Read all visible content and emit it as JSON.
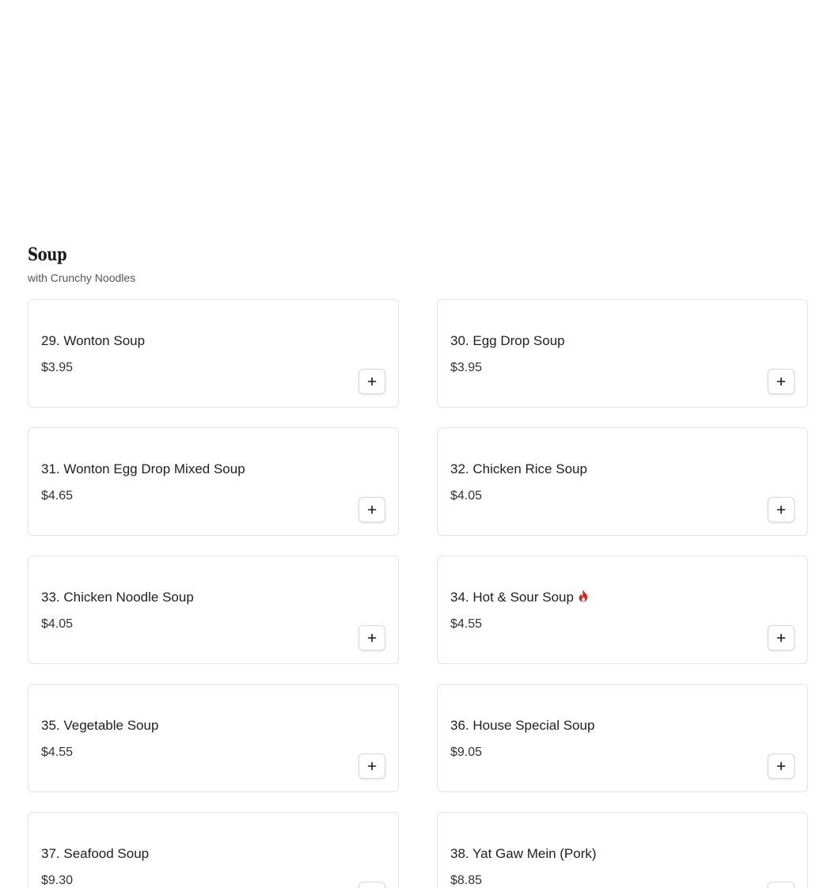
{
  "section": {
    "title": "Soup",
    "subtitle": "with Crunchy Noodles"
  },
  "items": [
    {
      "name": "29. Wonton Soup",
      "price": "$3.95",
      "spicy": false
    },
    {
      "name": "30. Egg Drop Soup",
      "price": "$3.95",
      "spicy": false
    },
    {
      "name": "31. Wonton Egg Drop Mixed Soup",
      "price": "$4.65",
      "spicy": false
    },
    {
      "name": "32. Chicken Rice Soup",
      "price": "$4.05",
      "spicy": false
    },
    {
      "name": "33. Chicken Noodle Soup",
      "price": "$4.05",
      "spicy": false
    },
    {
      "name": "34. Hot & Sour Soup",
      "price": "$4.55",
      "spicy": true
    },
    {
      "name": "35. Vegetable Soup",
      "price": "$4.55",
      "spicy": false
    },
    {
      "name": "36. House Special Soup",
      "price": "$9.05",
      "spicy": false
    },
    {
      "name": "37. Seafood Soup",
      "price": "$9.30",
      "spicy": false
    },
    {
      "name": "38. Yat Gaw Mein (Pork)",
      "price": "$8.85",
      "spicy": false
    }
  ],
  "icons": {
    "add": "plus-icon",
    "spicy": "flame-icon"
  },
  "colors": {
    "spicy": "#c62f24",
    "border": "#e3e3e3"
  }
}
